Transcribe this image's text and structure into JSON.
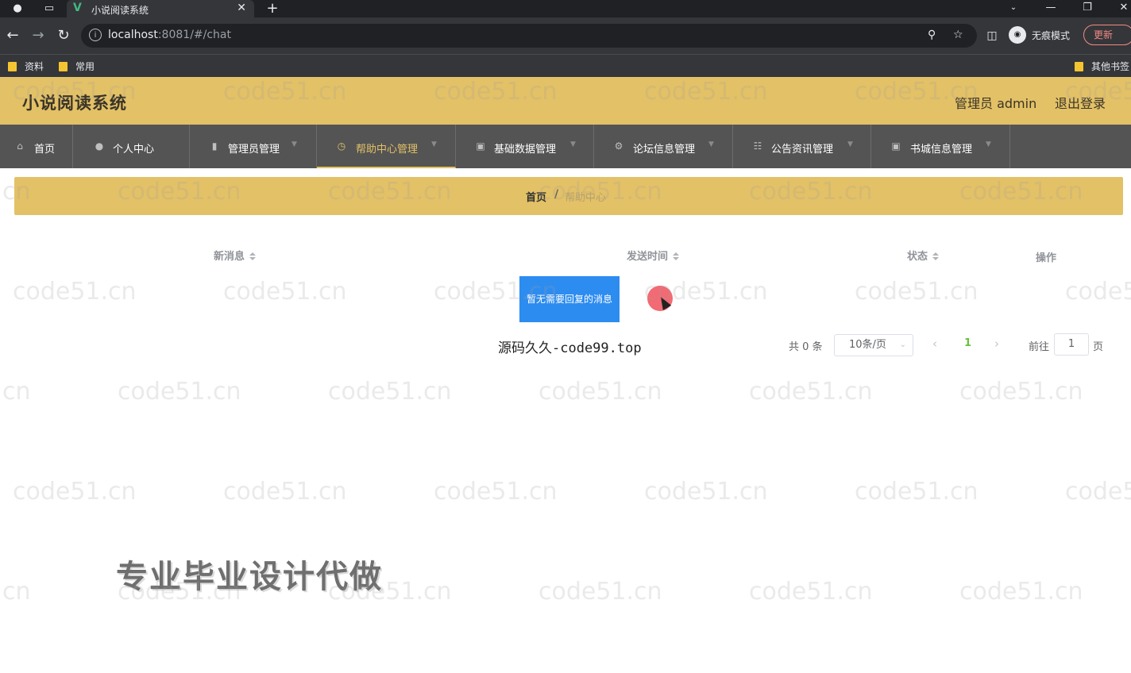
{
  "browser": {
    "tab_title": "小说阅读系统",
    "url_host": "localhost",
    "url_rest": ":8081/#/chat",
    "incognito_label": "无痕模式",
    "update_label": "更新",
    "bookmarks": [
      "资料",
      "常用"
    ],
    "other_bookmarks": "其他书签"
  },
  "header": {
    "title": "小说阅读系统",
    "user": "管理员 admin",
    "logout": "退出登录"
  },
  "menu": [
    {
      "label": "首页",
      "icon": "home-icon"
    },
    {
      "label": "个人中心",
      "icon": "user-icon"
    },
    {
      "label": "管理员管理",
      "icon": "suitcase-icon"
    },
    {
      "label": "帮助中心管理",
      "icon": "clock-icon"
    },
    {
      "label": "基础数据管理",
      "icon": "monitor-icon"
    },
    {
      "label": "论坛信息管理",
      "icon": "settings-icon"
    },
    {
      "label": "公告资讯管理",
      "icon": "doc-icon"
    },
    {
      "label": "书城信息管理",
      "icon": "monitor-icon"
    }
  ],
  "breadcrumb": {
    "home": "首页",
    "separator": "/",
    "current": "帮助中心"
  },
  "table": {
    "columns": [
      "新消息",
      "发送时间",
      "状态",
      "操作"
    ],
    "empty_text": "暂无需要回复的消息"
  },
  "site_mark": "源码久久-code99.top",
  "pagination": {
    "total": "共 0 条",
    "page_size": "10条/页",
    "current_page": "1",
    "goto_label": "前往",
    "goto_value": "1",
    "page_unit": "页"
  },
  "promo": "专业毕业设计代做",
  "watermark": "code51.cn",
  "colors": {
    "accent": "#e3c166",
    "menu_bg": "#545454",
    "empty_tip_bg": "#2d8cf0",
    "active_page": "#67c23a"
  }
}
